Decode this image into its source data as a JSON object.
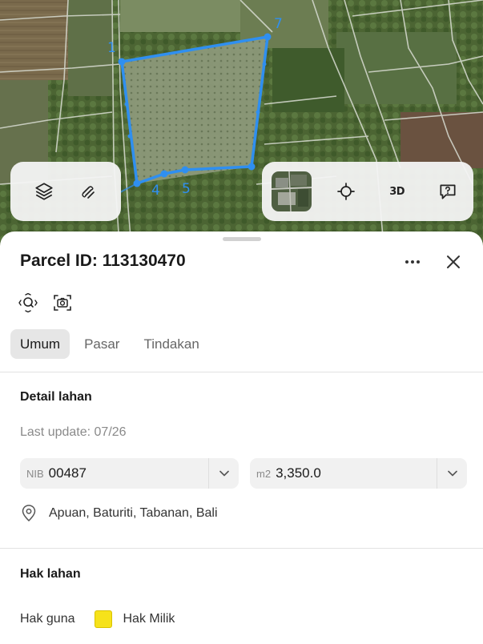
{
  "map": {
    "vertex_labels": [
      "1",
      "7",
      "4",
      "5"
    ],
    "colors": {
      "parcel_outline": "#2f8ff0",
      "terrain": "#556b3e"
    }
  },
  "map_controls": {
    "left": [
      "layers-icon",
      "measure-icon"
    ],
    "right": [
      "satellite-thumbnail",
      "locate-icon",
      "3d-toggle",
      "feedback-icon"
    ],
    "three_d_label": "3D"
  },
  "sheet": {
    "title": "Parcel ID: 113130470",
    "tabs": [
      "Umum",
      "Pasar",
      "Tindakan"
    ],
    "active_tab": "Umum",
    "detail": {
      "heading": "Detail lahan",
      "last_update": "Last update: 07/26",
      "nib_prefix": "NIB",
      "nib_value": "00487",
      "area_prefix": "m2",
      "area_value": "3,350.0",
      "address": "Apuan, Baturiti, Tabanan, Bali"
    },
    "rights": {
      "heading": "Hak lahan",
      "label": "Hak guna",
      "value": "Hak Milik",
      "swatch_color": "#f6e21b"
    }
  }
}
